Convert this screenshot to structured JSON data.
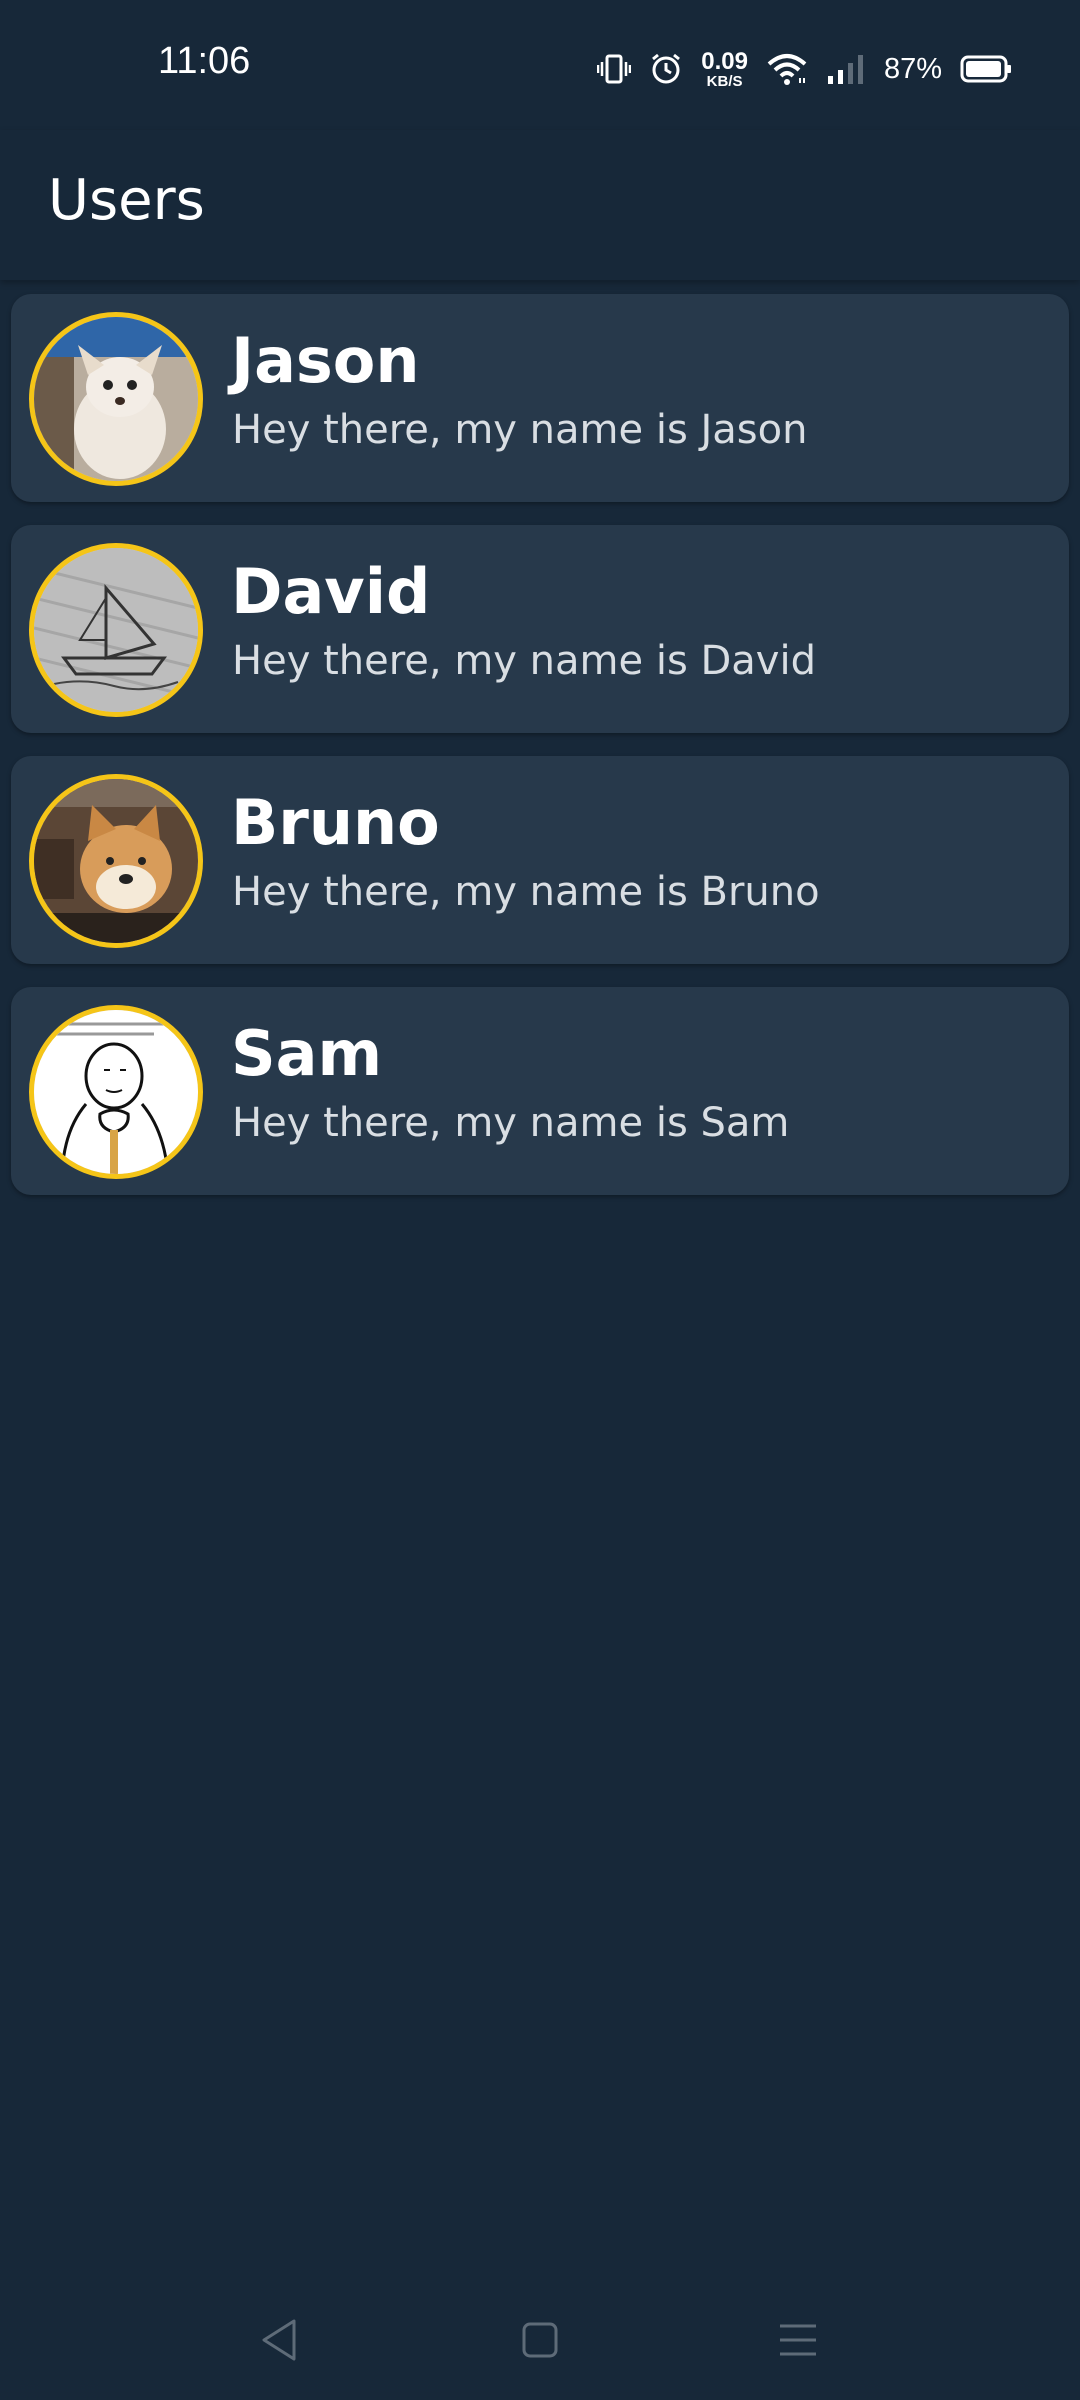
{
  "status_bar": {
    "time": "11:06",
    "net_speed_value": "0.09",
    "net_speed_unit": "KB/S",
    "battery_percent": "87%",
    "icons": [
      "vibrate-icon",
      "alarm-icon",
      "wifi-icon",
      "signal-icon",
      "battery-icon"
    ]
  },
  "app_bar": {
    "title": "Users"
  },
  "users": [
    {
      "name": "Jason",
      "bio": "Hey there, my name is Jason",
      "avatar": "chihuahua-photo"
    },
    {
      "name": "David",
      "bio": "Hey there, my name is David",
      "avatar": "ship-sketch"
    },
    {
      "name": "Bruno",
      "bio": "Hey there, my name is Bruno",
      "avatar": "shiba-meme"
    },
    {
      "name": "Sam",
      "bio": "Hey there, my name is Sam",
      "avatar": "comic-face-meme"
    }
  ],
  "nav_bar": {
    "icons": [
      "back-icon",
      "home-icon",
      "menu-icon"
    ]
  },
  "colors": {
    "background": "#172839",
    "card": "#27394b",
    "avatar_border": "#f5c518",
    "text_primary": "#ffffff",
    "text_secondary": "#d9dee3"
  }
}
